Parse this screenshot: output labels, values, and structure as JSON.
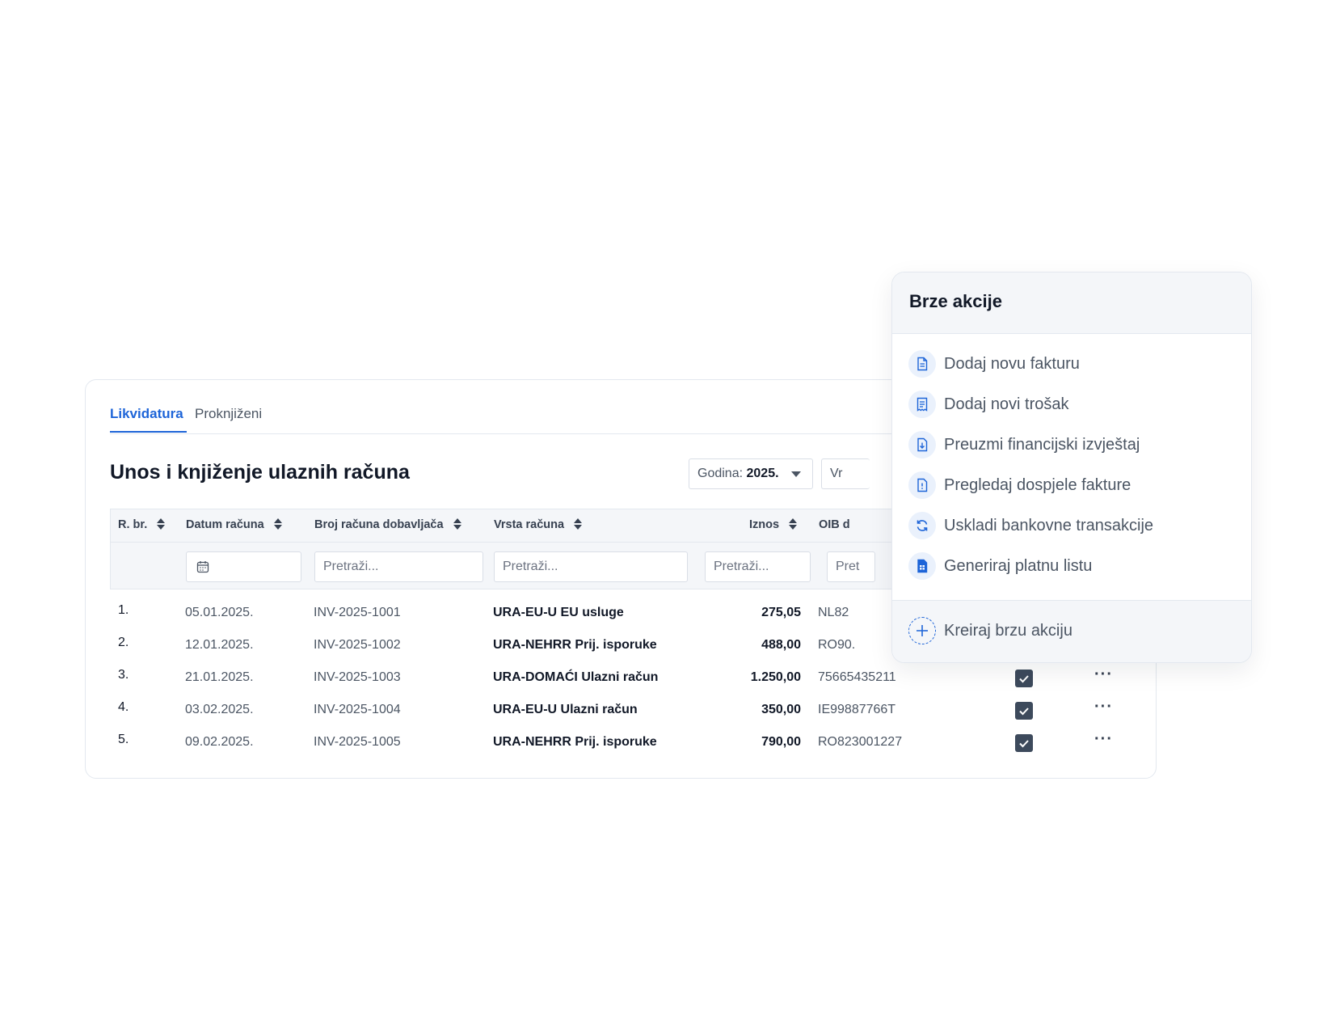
{
  "tabs": [
    {
      "label": "Likvidatura",
      "active": true
    },
    {
      "label": "Proknjiženi",
      "active": false
    }
  ],
  "page_title": "Unos i knjiženje ulaznih računa",
  "filters": {
    "year_label": "Godina:",
    "year_value": "2025.",
    "second_filter_partial": "Vr"
  },
  "table": {
    "columns": {
      "rbr": "R. br.",
      "datum": "Datum računa",
      "broj": "Broj računa dobavljača",
      "vrsta": "Vrsta računa",
      "iznos": "Iznos",
      "oib": "OIB d"
    },
    "search_placeholder": "Pretraži...",
    "oib_search_partial": "Pret",
    "rows": [
      {
        "rbr": "1.",
        "datum": "05.01.2025.",
        "broj": "INV-2025-1001",
        "vrsta": "URA-EU-U EU usluge",
        "iznos": "275,05",
        "oib": "NL82"
      },
      {
        "rbr": "2.",
        "datum": "12.01.2025.",
        "broj": "INV-2025-1002",
        "vrsta": "URA-NEHRR Prij. isporuke",
        "iznos": "488,00",
        "oib": "RO90."
      },
      {
        "rbr": "3.",
        "datum": "21.01.2025.",
        "broj": "INV-2025-1003",
        "vrsta": "URA-DOMAĆI Ulazni račun",
        "iznos": "1.250,00",
        "oib": "75665435211"
      },
      {
        "rbr": "4.",
        "datum": "03.02.2025.",
        "broj": "INV-2025-1004",
        "vrsta": "URA-EU-U Ulazni račun",
        "iznos": "350,00",
        "oib": "IE99887766T"
      },
      {
        "rbr": "5.",
        "datum": "09.02.2025.",
        "broj": "INV-2025-1005",
        "vrsta": "URA-NEHRR Prij. isporuke",
        "iznos": "790,00",
        "oib": "RO823001227"
      }
    ],
    "more_glyph": "···"
  },
  "quick_actions": {
    "title": "Brze akcije",
    "items": [
      {
        "label": "Dodaj novu fakturu",
        "icon": "document-icon"
      },
      {
        "label": "Dodaj novi trošak",
        "icon": "receipt-icon"
      },
      {
        "label": "Preuzmi financijski izvještaj",
        "icon": "download-document-icon"
      },
      {
        "label": "Pregledaj dospjele fakture",
        "icon": "alert-document-icon"
      },
      {
        "label": "Uskladi bankovne transakcije",
        "icon": "sync-icon"
      },
      {
        "label": "Generiraj platnu listu",
        "icon": "spreadsheet-document-icon"
      }
    ],
    "create_label": "Kreiraj brzu akciju"
  },
  "colors": {
    "accent": "#1d64d8",
    "checkbox": "#3d4a5c",
    "header_bg": "#f4f6f9"
  }
}
